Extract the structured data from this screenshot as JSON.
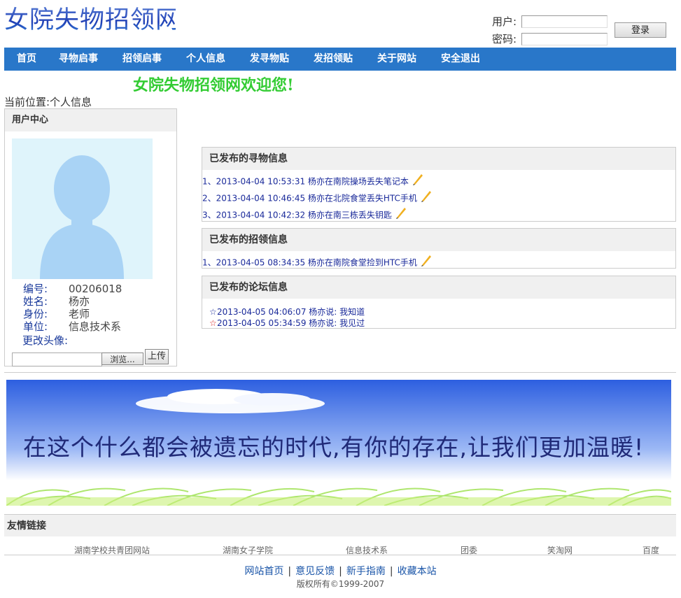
{
  "header": {
    "logo_text": "女院失物招领网",
    "user_label": "用户:",
    "user_value": "",
    "password_label": "密码:",
    "password_value": "",
    "login_button": "登录"
  },
  "nav": {
    "items": [
      "首页",
      "寻物启事",
      "招领启事",
      "个人信息",
      "发寻物贴",
      "发招领贴",
      "关于网站",
      "安全退出"
    ]
  },
  "welcome": "女院失物招领网欢迎您!",
  "breadcrumb": "当前位置:个人信息",
  "user_center": {
    "title": "用户中心",
    "fields": [
      {
        "key": "编号:",
        "value": "00206018"
      },
      {
        "key": "姓名:",
        "value": "杨亦"
      },
      {
        "key": "身份:",
        "value": "老师"
      },
      {
        "key": "单位:",
        "value": "信息技术系"
      }
    ],
    "change_avatar_label": "更改头像:",
    "browse_button": "浏览...",
    "upload_button": "上传"
  },
  "lost_posts": {
    "title": "已发布的寻物信息",
    "items": [
      "1、2013-04-04 10:53:31 杨亦在南院操场丢失笔记本",
      "2、2013-04-04 10:46:45 杨亦在北院食堂丢失HTC手机",
      "3、2013-04-04 10:42:32 杨亦在南三栋丢失钥匙"
    ]
  },
  "found_posts": {
    "title": "已发布的招领信息",
    "items": [
      "1、2013-04-05 08:34:35 杨亦在南院食堂捡到HTC手机"
    ]
  },
  "forum_posts": {
    "title": "已发布的论坛信息",
    "items": [
      {
        "star": "☆",
        "text": "2013-04-05 04:06:07 杨亦说:  我知道",
        "star_color": "#1a2a9a"
      },
      {
        "star": "☆",
        "text": "2013-04-05 05:34:59 杨亦说:  我见过",
        "star_color": "#d62020"
      }
    ]
  },
  "banner": {
    "slogan": "在这个什么都会被遗忘的时代,有你的存在,让我们更加温暖!"
  },
  "friend_links": {
    "title": "友情链接",
    "items": [
      "湖南学校共青团网站",
      "湖南女子学院",
      "信息技术系",
      "团委",
      "笑淘网",
      "百度"
    ]
  },
  "footer": {
    "links": [
      "网站首页",
      "意见反馈",
      "新手指南",
      "收藏本站"
    ],
    "separator": "|",
    "copyright": "版权所有©1999-2007"
  },
  "colors": {
    "nav_bg": "#2977c9",
    "welcome": "#33cc33",
    "link": "#1a2a9a"
  }
}
